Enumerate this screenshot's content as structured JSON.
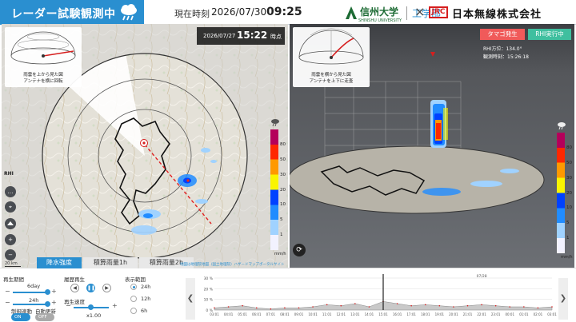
{
  "header": {
    "title": "レーダー試験観測中",
    "current_time_label": "現在時刻",
    "current_date": "2026/07/30",
    "current_clock": "09:25",
    "university_name": "信州大学",
    "university_sub": "SHINSHU UNIVERSITY",
    "department": "工学部",
    "cross": "×",
    "jrc_logo": "JRC",
    "company_name": "日本無線株式会社"
  },
  "left_view": {
    "hemi_caption_line1": "雨雲を上から見た図",
    "hemi_caption_line2": "アンテナを横に回転",
    "obs_date": "2026/07/27",
    "obs_time": "15:22",
    "obs_time_suffix": "時点",
    "scale_label": "20 km"
  },
  "right_view": {
    "hemi_caption_line1": "雨雲を横から見た図",
    "hemi_caption_line2": "アンテナを上下に走査",
    "badge_tamago": "タマゴ発生",
    "badge_rhi": "RHI実行中",
    "rhi_azimuth": "RHI方位：134.0°",
    "obs_time_text": "観測時刻：15:26:18"
  },
  "side_buttons": {
    "rhi": "RHI",
    "more": "…",
    "locate": "⌖",
    "zoom_in": "+",
    "zoom_out": "−",
    "reset": "⟳"
  },
  "legend": {
    "labels": [
      "80",
      "50",
      "30",
      "20",
      "10",
      "5",
      "1"
    ],
    "unit": "mm/h",
    "colors": [
      "#b4005a",
      "#ff2800",
      "#ff9900",
      "#faf500",
      "#0041ff",
      "#218cff",
      "#a0d2ff",
      "#f2f2ff"
    ]
  },
  "tabs": [
    {
      "label": "降水強度",
      "active": true
    },
    {
      "label": "積算雨量1h",
      "active": false
    },
    {
      "label": "積算雨量2h",
      "active": false
    }
  ],
  "source_link": "地図は地理院地図（国土地理院）ハザードマップポータルサイト",
  "controls": {
    "playback_period_label": "再生期間",
    "period_value": "6day",
    "hours_value": "24h",
    "sync_label": "制御連動",
    "auto_update_label": "自動更新",
    "sync_state": "ON",
    "auto_state": "OFF",
    "history_label": "履歴再生",
    "play_speed_label": "再生速度",
    "speed_value": "x1.00",
    "display_range_label": "表示範囲",
    "range_options": [
      "24h",
      "12h",
      "6h"
    ],
    "range_selected": "24h"
  },
  "chart_data": {
    "type": "area",
    "title": "",
    "xlabel": "",
    "ylabel": "",
    "ylim": [
      0,
      30
    ],
    "yticks": [
      "30 %",
      "20 %",
      "10 %",
      "0 %"
    ],
    "top_label": "07/28",
    "x": [
      "03:01",
      "04:01",
      "05:01",
      "06:01",
      "07:01",
      "08:01",
      "09:01",
      "10:01",
      "11:01",
      "12:01",
      "13:01",
      "14:01",
      "15:01",
      "16:01",
      "17:01",
      "18:01",
      "19:01",
      "20:01",
      "21:01",
      "22:01",
      "23:01",
      "00:01",
      "01:01",
      "02:01",
      "03:01"
    ],
    "values": [
      2,
      3,
      4,
      2,
      1,
      2,
      2,
      3,
      5,
      4,
      6,
      3,
      8,
      6,
      4,
      5,
      4,
      3,
      4,
      5,
      4,
      3,
      3,
      2,
      3
    ],
    "marker_x": "15:01"
  }
}
